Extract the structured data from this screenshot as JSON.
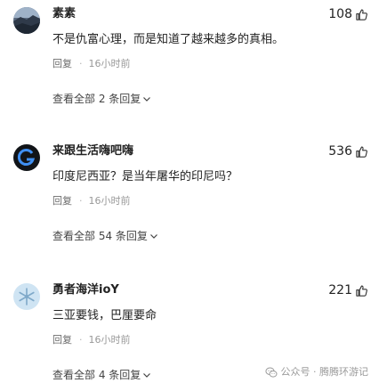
{
  "comments": [
    {
      "username": "素素",
      "likes": "108",
      "text": "不是仇富心理，而是知道了越来越多的真相。",
      "reply_label": "回复",
      "separator": "·",
      "time": "16小时前",
      "view_replies": "查看全部 2 条回复"
    },
    {
      "username": "来跟生活嗨吧嗨",
      "likes": "536",
      "text": "印度尼西亚？是当年屠华的印尼吗？",
      "reply_label": "回复",
      "separator": "·",
      "time": "16小时前",
      "view_replies": "查看全部 54 条回复"
    },
    {
      "username": "勇者海洋ioY",
      "likes": "221",
      "text": "三亚要钱，巴厘要命",
      "reply_label": "回复",
      "separator": "·",
      "time": "16小时前",
      "view_replies": "查看全部 4 条回复"
    }
  ],
  "watermark": "公众号 · 腾腾环游记",
  "colors": {
    "text": "#222222",
    "meta": "#999999",
    "link": "#444444"
  }
}
